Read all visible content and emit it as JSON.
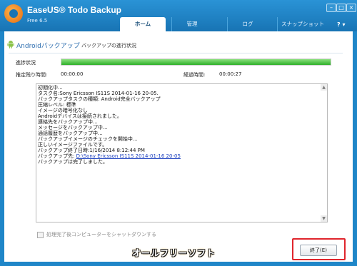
{
  "app": {
    "title": "EaseUS® Todo Backup",
    "edition": "Free 6.5",
    "window_controls": [
      "–",
      "□",
      "×"
    ]
  },
  "tabs": [
    {
      "label": "ホーム",
      "active": true
    },
    {
      "label": "管理",
      "active": false
    },
    {
      "label": "ログ",
      "active": false
    },
    {
      "label": "スナップショット",
      "active": false
    }
  ],
  "help_label": "?",
  "section": {
    "title": "Androidバックアップ",
    "subtitle": "バックアップの進行状況"
  },
  "progress": {
    "label": "進捗状況",
    "fraction": 1.0
  },
  "times": {
    "remaining_label": "推定残り時間:",
    "remaining_value": "00:00:00",
    "elapsed_label": "経過時間:",
    "elapsed_value": "00:00:27"
  },
  "log": [
    {
      "text": "初期化中..."
    },
    {
      "text": "タスク名:Sony Ericsson IS11S 2014-01-16 20-05."
    },
    {
      "text": "バックアップタスクの種類: Android完全バックアップ"
    },
    {
      "text": "圧縮レベル: 標準"
    },
    {
      "text": "イメージの暗号化なし"
    },
    {
      "text": "Androidデバイスは接続されました。"
    },
    {
      "text": "連絡先をバックアップ中..."
    },
    {
      "text": "メッセージをバックアップ中..."
    },
    {
      "text": "通話履歴をバックアップ中..."
    },
    {
      "text": "バックアップイメージのチェックを開始中..."
    },
    {
      "text": "正しいイメージファイルです。"
    },
    {
      "text": "バックアップ終了日時:1/16/2014 8:12:44 PM"
    },
    {
      "prefix": "バックアップ先: ",
      "link": "D:\\Sony Ericsson IS11S 2014-01-16 20-05"
    },
    {
      "text": "バックアップは完了しました。"
    }
  ],
  "shutdown_checkbox": {
    "label": "処理完了後コンピューターをシャットダウンする",
    "checked": false,
    "enabled": false
  },
  "finish_button": {
    "label": "終了(E)"
  },
  "watermark": "オールフリーソフト",
  "colors": {
    "brand_blue": "#1f86c8",
    "progress_green": "#2fb02a",
    "highlight_red": "#e0252c",
    "link_blue": "#1a3fbf"
  }
}
